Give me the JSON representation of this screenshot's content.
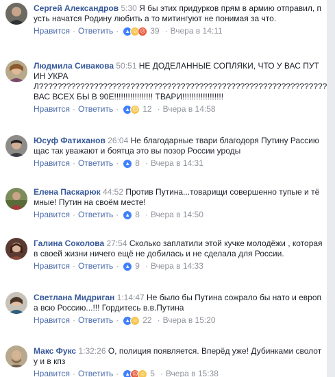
{
  "ui": {
    "reply_label": "Ответить",
    "separator": "·",
    "timestamp_separator": "·"
  },
  "comments": [
    {
      "author": "Сергей Александров",
      "video_time": "5:30",
      "text": "Я бы этих придурков прям в армию отправил, пусть начатся Родину любить а то митингуют не понимая за что.",
      "like_label": "Нравится",
      "count": "39",
      "timestamp": "Вчера в 14:11",
      "reactions": [
        "like-icon",
        "haha-icon",
        "angry-icon"
      ]
    },
    {
      "author": "Людмила Сивакова",
      "video_time": "50:51",
      "text": "НЕ ДОДЕЛАННЫЕ СОПЛЯКИ, ЧТО У ВАС ПУТИН УКРАЛ?????????????????????????????????????????????????????????????????????????????ВАС ВСЕХ БЫ В 90Е!!!!!!!!!!!!!!!!! ТВАРИ!!!!!!!!!!!!!!!!!!",
      "like_label": "Нравится",
      "count": "12",
      "timestamp": "Вчера в 14:58",
      "reactions": [
        "like-icon",
        "sad-icon"
      ]
    },
    {
      "author": "Юсуф Фатиханов",
      "video_time": "26:04",
      "text": "Не благодарные твари благодоря Путину Рассию щас так уважают и боятца это вы позор России уроды",
      "like_label": "Нравится",
      "count": "8",
      "timestamp": "Вчера в 14:31",
      "reactions": [
        "like-icon"
      ]
    },
    {
      "author": "Елена Паскарюк",
      "video_time": "44:52",
      "text": "Против Путина...товарищи совершенно тупые и тёмные! Путин на своём месте!",
      "like_label": "Нравится",
      "count": "8",
      "timestamp": "Вчера в 14:50",
      "reactions": [
        "like-icon"
      ]
    },
    {
      "author": "Галина Соколова",
      "video_time": "27:54",
      "text": "Сколько заплатили этой кучке молодёжи , которая в своей жизни ничего ещё не добилась и не сделала для России.",
      "like_label": "Нравится",
      "count": "9",
      "timestamp": "Вчера в 14:33",
      "reactions": [
        "like-icon"
      ]
    },
    {
      "author": "Светлана Мидриган",
      "video_time": "1:14:47",
      "text": "Не было бы Путина сожрало бы нато и европа всю Россию...!!! Гордитесь в.в.Путина",
      "like_label": "Нравится",
      "count": "22",
      "timestamp": "Вчера в 15:20",
      "reactions": [
        "like-icon",
        "haha-icon"
      ]
    },
    {
      "author": "Макс Фукс",
      "video_time": "1:32:26",
      "text": "О, полиция появляется. Вперёд уже! Дубинками сволоту и в кпз",
      "like_label": "Нравится",
      "count": "5",
      "timestamp": "Вчера в 15:38",
      "reactions": [
        "like-icon",
        "angry-icon",
        "haha-icon"
      ]
    }
  ],
  "colors": {
    "author": "#365899",
    "link": "#4b6baa",
    "meta": "#90949c",
    "text": "#1d2129",
    "like": "#4080ff",
    "haha": "#f7c652",
    "angry": "#e95a3c"
  }
}
